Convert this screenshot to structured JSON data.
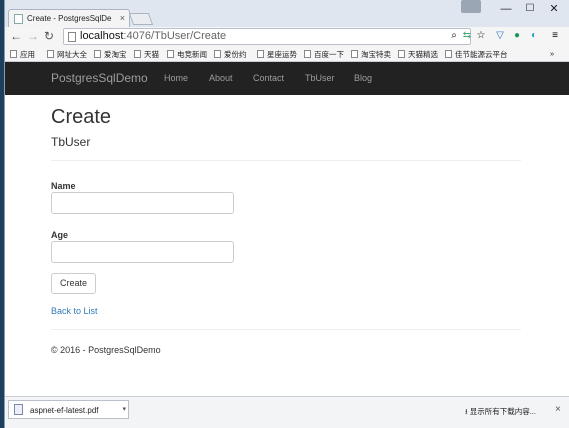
{
  "browser": {
    "tab_title": "Create - PostgresSqlDe",
    "tab_close": "×",
    "url_host": "localhost",
    "url_path": ":4076/TbUser/Create",
    "window_controls": {
      "minimize": "—",
      "maximize": "☐",
      "close": "✕"
    },
    "bookmarks": [
      "应用",
      "网址大全",
      "爱淘宝",
      "天猫",
      "电竞新闻",
      "爱份约",
      "星座运势",
      "百度一下",
      "淘宝特卖",
      "天猫精选",
      "佳节能源云平台"
    ],
    "bookmarks_overflow": "»"
  },
  "navbar": {
    "brand": "PostgresSqlDemo",
    "links": [
      "Home",
      "About",
      "Contact",
      "TbUser",
      "Blog"
    ]
  },
  "page": {
    "title": "Create",
    "subtitle": "TbUser",
    "fields": [
      {
        "label": "Name",
        "value": ""
      },
      {
        "label": "Age",
        "value": ""
      }
    ],
    "submit_label": "Create",
    "back_link": "Back to List",
    "footer": "© 2016 - PostgresSqlDemo"
  },
  "downloads": {
    "file_name": "aspnet-ef-latest.pdf",
    "show_all": "显示所有下载内容...",
    "close": "×"
  },
  "colors": {
    "navbar_bg": "#222222",
    "nav_text": "#9d9d9d",
    "link": "#337ab7"
  }
}
